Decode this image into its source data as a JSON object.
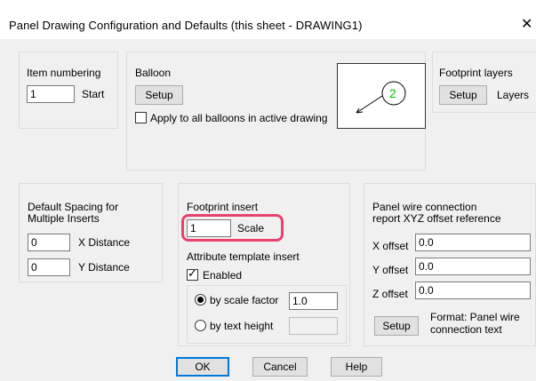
{
  "window": {
    "title": "Panel Drawing Configuration and Defaults (this sheet - DRAWING1)",
    "close_glyph": "✕"
  },
  "item_numbering": {
    "label": "Item numbering",
    "value": "1",
    "start_label": "Start"
  },
  "balloon": {
    "label": "Balloon",
    "setup_label": "Setup",
    "apply_label": "Apply to all balloons in active drawing",
    "apply_checked": false,
    "preview_number": "2",
    "preview_color": "#00c000"
  },
  "footprint_layers": {
    "label": "Footprint layers",
    "setup_label": "Setup",
    "layers_label": "Layers"
  },
  "default_spacing": {
    "label_line1": "Default Spacing for",
    "label_line2": "Multiple Inserts",
    "x_value": "0",
    "x_label": "X Distance",
    "y_value": "0",
    "y_label": "Y Distance"
  },
  "footprint_insert": {
    "label": "Footprint insert",
    "scale_value": "1",
    "scale_label": "Scale",
    "highlight_color": "#e8426d"
  },
  "attribute_template": {
    "label": "Attribute template insert",
    "enabled_label": "Enabled",
    "enabled_checked": true,
    "by_scale_label": "by scale factor",
    "by_scale_selected": true,
    "scale_factor_value": "1.0",
    "by_text_height_label": "by text height",
    "text_height_value": ""
  },
  "panel_wire": {
    "label_line1": "Panel wire connection",
    "label_line2": "report XYZ offset reference",
    "x_label": "X offset",
    "x_value": "0.0",
    "y_label": "Y offset",
    "y_value": "0.0",
    "z_label": "Z offset",
    "z_value": "0.0",
    "setup_label": "Setup",
    "format_line1": "Format: Panel wire",
    "format_line2": "connection text"
  },
  "footer": {
    "ok_label": "OK",
    "cancel_label": "Cancel",
    "help_label": "Help"
  }
}
